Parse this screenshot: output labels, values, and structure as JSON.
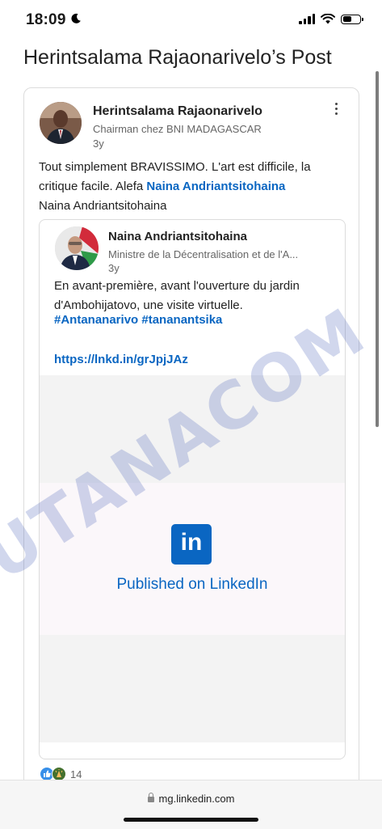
{
  "status_bar": {
    "time": "18:09",
    "battery_level": 0.55
  },
  "page_title": "Herintsalama Rajaonarivelo’s Post",
  "post": {
    "author_name": "Herintsalama Rajaonarivelo",
    "author_title": "Chairman chez BNI MADAGASCAR",
    "age": "3y",
    "text_before": "Tout simplement BRAVISSIMO. L'art est difficile, la critique facile. Alefa ",
    "mention": "Naina Andriantsitohaina",
    "text_after": "Naina Andriantsitohaina",
    "reaction_count": "14"
  },
  "shared_post": {
    "author_name": "Naina Andriantsitohaina",
    "author_title": "Ministre de la Décentralisation et de l'A...",
    "age": "3y",
    "text": "En avant-première, avant l'ouverture du jardin d'Ambohijatovo, une visite virtuelle.",
    "hashtags": "#Antananarivo #tananantsika",
    "link": "https://lnkd.in/grJpjJAz",
    "media_logo_text": "in",
    "media_caption": "Published on LinkedIn"
  },
  "watermark": "UTANACOM",
  "browser": {
    "url": "mg.linkedin.com"
  },
  "icons": [
    "moon-icon",
    "signal-icon",
    "wifi-icon",
    "battery-icon",
    "more-options-icon",
    "like-reaction-icon",
    "celebrate-reaction-icon",
    "lock-icon"
  ]
}
